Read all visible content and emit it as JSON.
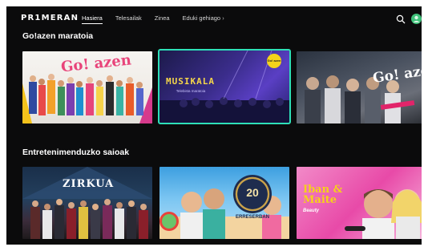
{
  "header": {
    "logo": "PR1MERAN",
    "nav": [
      "Hasiera",
      "Telesailak",
      "Zinea",
      "Eduki gehiago"
    ],
    "nav_more_chevron": "›"
  },
  "sections": [
    {
      "title": "Go!azen maratoia",
      "cards": [
        {
          "title": "Go! azen"
        },
        {
          "title": "MUSIKALA",
          "subtitle": "Telebista maratoia",
          "badge": "Go! azen"
        },
        {
          "title": "Go! azen"
        }
      ]
    },
    {
      "title": "Entretenimenduzko saioak",
      "cards": [
        {
          "title": "ZIRKUA"
        },
        {
          "title": "20",
          "subtitle": "ERRESERBAN"
        },
        {
          "title": "Iban & Maite",
          "subtitle": "Beauty"
        }
      ]
    }
  ],
  "colors": {
    "background": "#0b0b0c",
    "selected_border": "#2ee0b8",
    "avatar": "#3fc27a"
  }
}
